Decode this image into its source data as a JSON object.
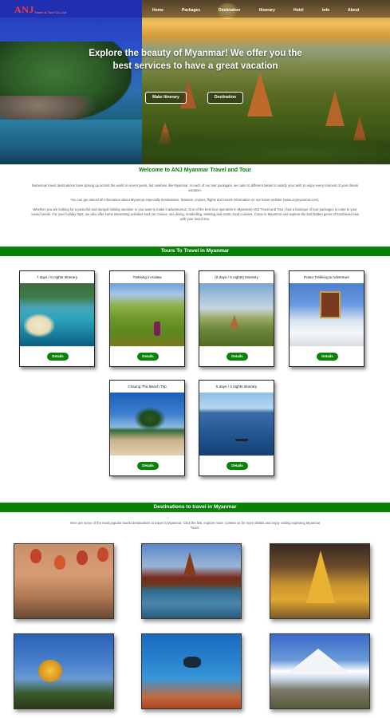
{
  "brand": {
    "logo": "ANJ",
    "tagline": "Travel & Tour Co.,Ltd"
  },
  "nav": {
    "items": [
      "Home",
      "Packages",
      "Destination",
      "Itinerary",
      "Hotel",
      "Info",
      "About"
    ]
  },
  "hero": {
    "title": "Explore the beauty of Myanmar! We offer you the best services to have a great vacation",
    "buttons": [
      "Make Itinerary",
      "Destination"
    ]
  },
  "welcome": {
    "title": "Welcome to ANJ Myanmar Travel and Tour",
    "p1": "Numerous travel destinations have sprung up across the world in recent years, but nowhere like Myanmar. In each of our tour packages, we cater to different tastes to satisfy your wish to enjoy every moment of your dream vacation.",
    "p2": "You can get almost all information about Myanmar especially destinations, features, cruises, flights and Hotels information on our travel website (www.anjmyanmar.com).",
    "p3": "Whether you are looking for a peaceful and tranquil holiday vacation or you want to make it adventurous, One of the best tour operators in Myanmar) ANJ Travel and Tour ) has a boutique of tour packages to cater to your varied needs. For your holiday trips, we also offer some interesting activities such as cruises, sea diving, snorkelling, trekking and exotic local cuisines. Come to Myanmar and explore the last hidden gems of Southeast Asia with your loved one."
  },
  "tours": {
    "heading": "Tours To Travel in Myanmar",
    "button_label": "Details",
    "cards": [
      {
        "title": "7 days / 6 nights Itinerary"
      },
      {
        "title": "Trekking in Kalaw"
      },
      {
        "title": "(6 days / 5 nights) Itinerary"
      },
      {
        "title": "Putao Trekking & Adventure"
      },
      {
        "title": "Chaung Tha Beach Trip"
      },
      {
        "title": "5 days / 4 nights Itinerary"
      }
    ]
  },
  "destinations": {
    "heading": "Destinations to travel in Myanmar",
    "intro": "Here are some of the most popular tourist destinations to travel in Myanmar. Click the link, explore more, contact us for more details and enjoy visiting exploring Myanmar Tours."
  },
  "colors": {
    "accent_green": "#078207",
    "logo_red": "#ff3a3a",
    "link_green": "#5ba84a"
  }
}
